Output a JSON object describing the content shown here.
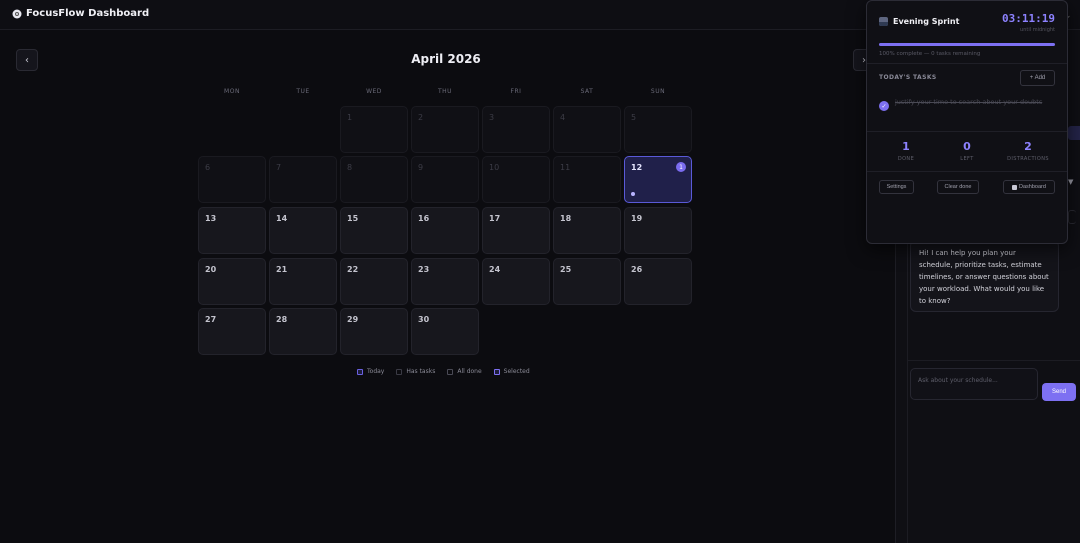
{
  "app": {
    "title": "FocusFlow Dashboard",
    "logo_icon": "flower-icon"
  },
  "calendar": {
    "month_label": "April 2026",
    "prev_icon": "chevron-left-icon",
    "next_icon": "chevron-right-icon",
    "weekdays": [
      "MON",
      "TUE",
      "WED",
      "THU",
      "FRI",
      "SAT",
      "SUN"
    ],
    "first_weekday_index": 2,
    "days_in_month": 30,
    "today": 12,
    "today_task_count": "1",
    "past_days_before_today": true,
    "legend": [
      {
        "label": "Today",
        "color": "#6a60e0"
      },
      {
        "label": "Has tasks",
        "color": "#3a3a44"
      },
      {
        "label": "All done",
        "color": "#4a4a55"
      },
      {
        "label": "Selected",
        "color": "#7d70f2"
      }
    ]
  },
  "chat": {
    "message": "Hi! I can help you plan your schedule, prioritize tasks, estimate timelines, or answer questions about your workload. What would you like to know?",
    "input_placeholder": "Ask about your schedule...",
    "send_label": "Send"
  },
  "sprint": {
    "icon": "night-city-icon",
    "title": "Evening Sprint",
    "timer": "03:11:19",
    "timer_sub": "until midnight",
    "progress_fraction": 1.0,
    "progress_text": "100% complete — 0 tasks remaining",
    "tasks_label": "TODAY'S TASKS",
    "add_label": "+ Add",
    "tasks": [
      {
        "text": "justify your time to search about your doubts",
        "done": true
      }
    ],
    "stats": [
      {
        "value": "1",
        "label": "DONE"
      },
      {
        "value": "0",
        "label": "LEFT"
      },
      {
        "value": "2",
        "label": "DISTRACTIONS"
      }
    ],
    "buttons": {
      "settings": "Settings",
      "clear_done": "Clear done",
      "dashboard": "Dashboard"
    }
  },
  "colors": {
    "accent": "#7d70f2",
    "background": "#0c0c10",
    "today_bg": "#20204a"
  }
}
